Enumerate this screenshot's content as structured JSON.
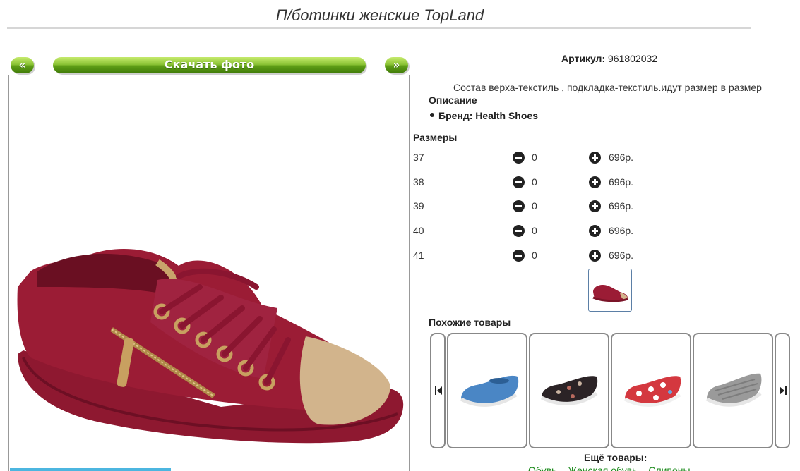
{
  "page": {
    "title": "П/ботинки женские TopLand"
  },
  "gallery": {
    "prev_label": "«",
    "download_label": "Скачать фото",
    "next_label": "»"
  },
  "product": {
    "article_label": "Артикул:",
    "article_value": "961802032",
    "composition": "Состав верха-текстиль , подкладка-текстиль.идут размер в размер",
    "description_label": "Описание",
    "brand_text": "Бренд: Health Shoes"
  },
  "sizes": {
    "label": "Размеры",
    "rows": [
      {
        "size": "37",
        "qty": "0",
        "price": "696р."
      },
      {
        "size": "38",
        "qty": "0",
        "price": "696р."
      },
      {
        "size": "39",
        "qty": "0",
        "price": "696р."
      },
      {
        "size": "40",
        "qty": "0",
        "price": "696р."
      },
      {
        "size": "41",
        "qty": "0",
        "price": "696р."
      }
    ]
  },
  "similar": {
    "label": "Похожие товары",
    "items": [
      {
        "icon": "blue-slip-on-shoe-icon",
        "color": "#4a86c5"
      },
      {
        "icon": "black-floral-slip-on-shoe-icon",
        "color": "#2b2326"
      },
      {
        "icon": "red-floral-slip-on-shoe-icon",
        "color": "#d4383f"
      },
      {
        "icon": "grey-slip-on-shoe-icon",
        "color": "#9a9a9a"
      }
    ]
  },
  "more": {
    "label": "Ещё товары:",
    "links": [
      "Обувь",
      "Женская обувь",
      "Слипоны"
    ]
  },
  "colors": {
    "button_green": "#5f9e17",
    "shoe_burgundy": "#9b1c35",
    "link_green": "#1a8a1a"
  }
}
